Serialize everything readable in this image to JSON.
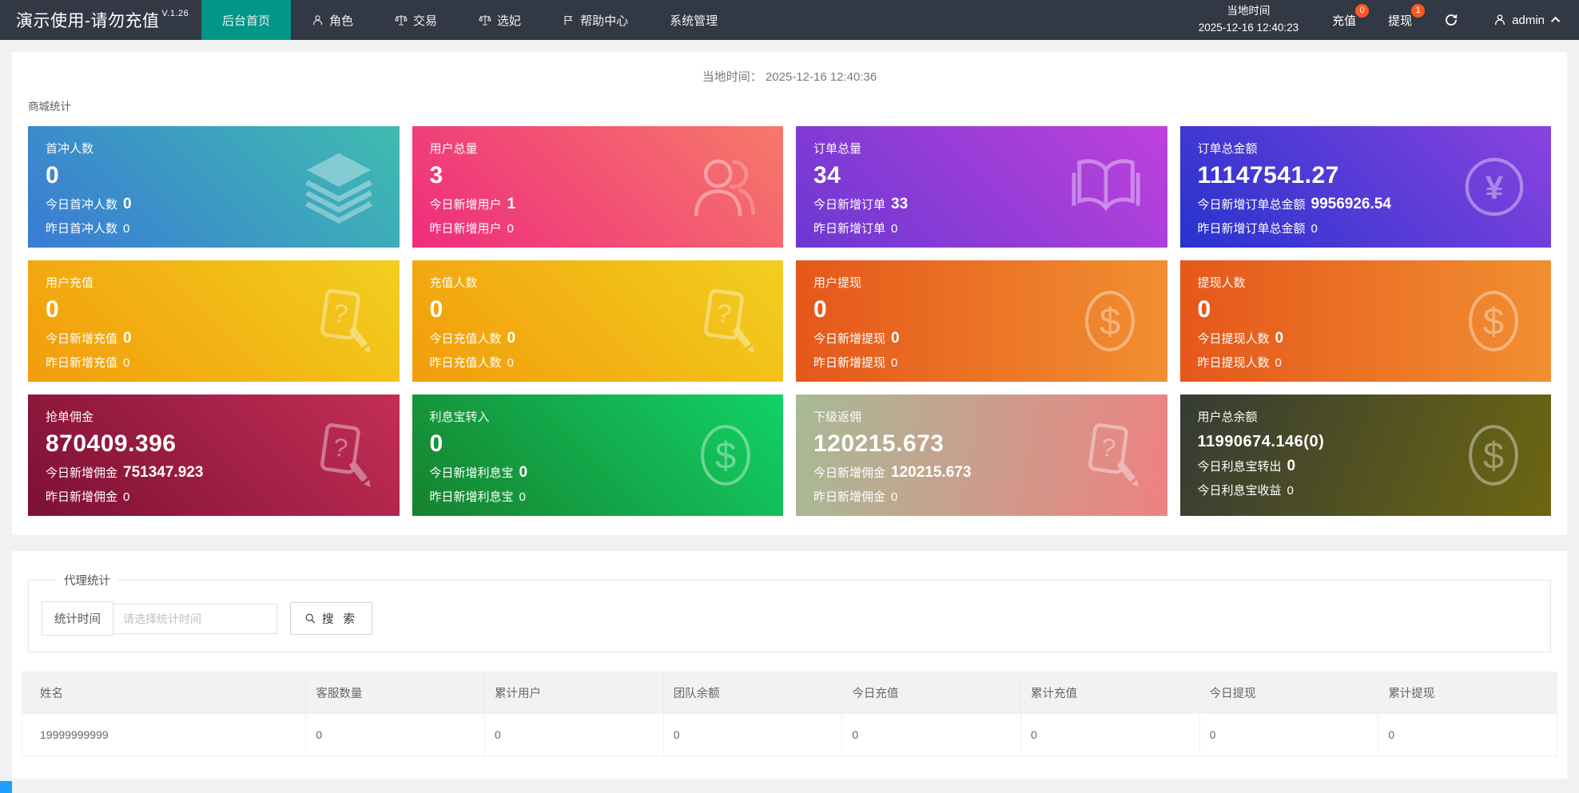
{
  "colors": {
    "topbar_bg": "#323945",
    "accent_teal": "#009688",
    "badge_orange": "#ff5722",
    "corner_blue": "#1e9fff"
  },
  "header": {
    "brand": "演示使用-请勿充值",
    "version": "V.1.26",
    "nav": [
      {
        "label": "后台首页"
      },
      {
        "label": "角色"
      },
      {
        "label": "交易"
      },
      {
        "label": "选妃"
      },
      {
        "label": "帮助中心"
      },
      {
        "label": "系统管理"
      }
    ],
    "local_time_label": "当地时间",
    "local_time_value": "2025-12-16 12:40:23",
    "recharge_label": "充值",
    "recharge_badge": "0",
    "withdraw_label": "提现",
    "withdraw_badge": "1",
    "username": "admin"
  },
  "main": {
    "time_label": "当地时间：",
    "time_value": "2025-12-16 12:40:36",
    "section_title": "商城统计",
    "cards": [
      {
        "title": "首冲人数",
        "value": "0",
        "today_label": "今日首冲人数",
        "today_value": "0",
        "yesterday_label": "昨日首冲人数",
        "yesterday_value": "0",
        "icon": "layers-icon",
        "gradient": {
          "angle": "45deg",
          "from": "#3a7bd5",
          "to": "#3fbcb0"
        }
      },
      {
        "title": "用户总量",
        "value": "3",
        "today_label": "今日新增用户",
        "today_value": "1",
        "yesterday_label": "昨日新增用户",
        "yesterday_value": "0",
        "icon": "user-icon",
        "gradient": {
          "angle": "45deg",
          "from": "#ee2c7e",
          "to": "#f7796a"
        }
      },
      {
        "title": "订单总量",
        "value": "34",
        "today_label": "今日新增订单",
        "today_value": "33",
        "yesterday_label": "昨日新增订单",
        "yesterday_value": "0",
        "icon": "book-icon",
        "gradient": {
          "angle": "45deg",
          "from": "#6c38d2",
          "to": "#bf41dc"
        }
      },
      {
        "title": "订单总金额",
        "value": "11147541.27",
        "today_label": "今日新增订单总金额",
        "today_value": "9956926.54",
        "yesterday_label": "昨日新增订单总金额",
        "yesterday_value": "0",
        "icon": "yen-icon",
        "gradient": {
          "angle": "45deg",
          "from": "#2733cd",
          "to": "#8a43e0"
        }
      },
      {
        "title": "用户充值",
        "value": "0",
        "today_label": "今日新增充值",
        "today_value": "0",
        "yesterday_label": "昨日新增充值",
        "yesterday_value": "0",
        "icon": "order-edit-icon",
        "gradient": {
          "angle": "45deg",
          "from": "#f29c0b",
          "to": "#f2cf1f"
        }
      },
      {
        "title": "充值人数",
        "value": "0",
        "today_label": "今日充值人数",
        "today_value": "0",
        "yesterday_label": "昨日充值人数",
        "yesterday_value": "0",
        "icon": "order-edit-icon",
        "gradient": {
          "angle": "45deg",
          "from": "#f29c0b",
          "to": "#f2cf1f"
        }
      },
      {
        "title": "用户提现",
        "value": "0",
        "today_label": "今日新增提现",
        "today_value": "0",
        "yesterday_label": "昨日新增提现",
        "yesterday_value": "0",
        "icon": "dollar-icon",
        "gradient": {
          "angle": "90deg",
          "from": "#e5571a",
          "to": "#f18f32"
        }
      },
      {
        "title": "提现人数",
        "value": "0",
        "today_label": "今日提现人数",
        "today_value": "0",
        "yesterday_label": "昨日提现人数",
        "yesterday_value": "0",
        "icon": "dollar-icon",
        "gradient": {
          "angle": "90deg",
          "from": "#e5571a",
          "to": "#f18f32"
        }
      },
      {
        "title": "抢单佣金",
        "value": "870409.396",
        "today_label": "今日新增佣金",
        "today_value": "751347.923",
        "yesterday_label": "昨日新增佣金",
        "yesterday_value": "0",
        "icon": "order-edit-icon",
        "gradient": {
          "angle": "45deg",
          "from": "#7c1034",
          "to": "#c42e56"
        }
      },
      {
        "title": "利息宝转入",
        "value": "0",
        "today_label": "今日新增利息宝",
        "today_value": "0",
        "yesterday_label": "昨日新增利息宝",
        "yesterday_value": "0",
        "icon": "dollar-icon",
        "gradient": {
          "angle": "45deg",
          "from": "#16812f",
          "to": "#12d266"
        }
      },
      {
        "title": "下级返佣",
        "value": "120215.673",
        "today_label": "今日新增佣金",
        "today_value": "120215.673",
        "yesterday_label": "昨日新增佣金",
        "yesterday_value": "0",
        "icon": "order-edit-icon",
        "gradient": {
          "angle": "100deg",
          "from": "#a8ba96",
          "to": "#ee8181"
        }
      },
      {
        "title": "用户总余额",
        "value": "11990674.146(0)",
        "today_label": "今日利息宝转出",
        "today_value": "0",
        "yesterday_label": "今日利息宝收益",
        "yesterday_value": "0",
        "icon": "dollar-icon",
        "gradient": {
          "angle": "110deg",
          "from": "#363b34",
          "to": "#6d6711"
        }
      }
    ]
  },
  "agent": {
    "legend": "代理统计",
    "filter_label": "统计时间",
    "filter_placeholder": "请选择统计时间",
    "search_label": "搜 索",
    "table": {
      "headers": [
        "姓名",
        "客服数量",
        "累计用户",
        "团队余额",
        "今日充值",
        "累计充值",
        "今日提现",
        "累计提现"
      ],
      "rows": [
        [
          "19999999999",
          "0",
          "0",
          "0",
          "0",
          "0",
          "0",
          "0"
        ]
      ]
    }
  }
}
